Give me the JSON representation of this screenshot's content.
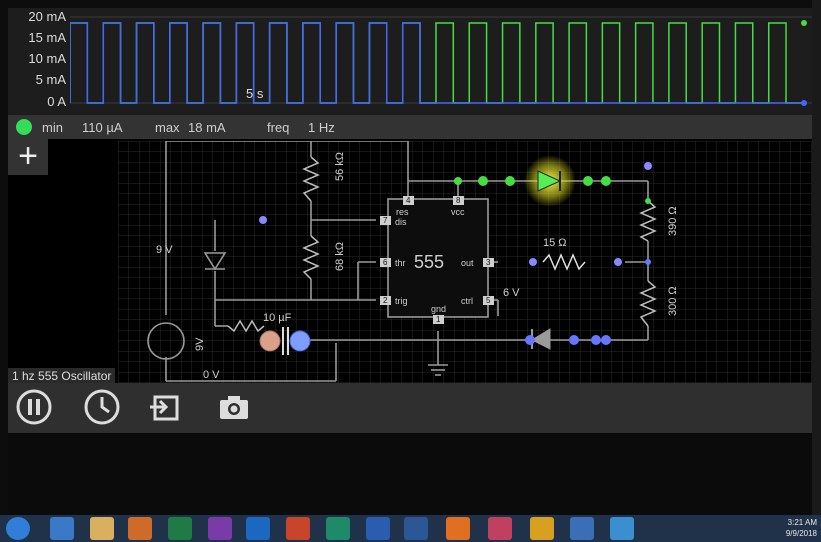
{
  "scope": {
    "axis_labels": [
      "20 mA",
      "15 mA",
      "10 mA",
      "5 mA",
      "0 A"
    ],
    "time_label": "5 s",
    "trace_colors": {
      "current": "#4466ff",
      "output": "#44dd44"
    }
  },
  "info_bar": {
    "min_label": "min",
    "min_value": "110 µA",
    "max_label": "max",
    "max_value": "18 mA",
    "freq_label": "freq",
    "freq_value": "1 Hz"
  },
  "circuit": {
    "title": "1 hz 555 Oscillator",
    "add_icon": "plus-icon",
    "labels": {
      "r1": "56 kΩ",
      "r2": "68 kΩ",
      "r3": "15 Ω",
      "r4": "390 Ω",
      "r5": "300 Ω",
      "cap": "10 µF",
      "battery": "9 V",
      "battery2": "9V",
      "v_out": "6 V",
      "v_gnd": "0 V",
      "chip": "555",
      "pin_res": "res",
      "pin_vcc": "vcc",
      "pin_dis": "dis",
      "pin_thr": "thr",
      "pin_out": "out",
      "pin_trig": "trig",
      "pin_ctrl": "ctrl",
      "pin_gnd": "gnd",
      "pin4": "4",
      "pin8": "8",
      "pin7": "7",
      "pin6": "6",
      "pin3": "3",
      "pin2": "2",
      "pin5": "5",
      "pin1": "1"
    }
  },
  "toolbar": {
    "buttons": [
      "pause-icon",
      "clock-icon",
      "export-icon",
      "camera-icon"
    ]
  },
  "taskbar": {
    "clock_time": "3:21 AM",
    "clock_date": "9/9/2018"
  }
}
